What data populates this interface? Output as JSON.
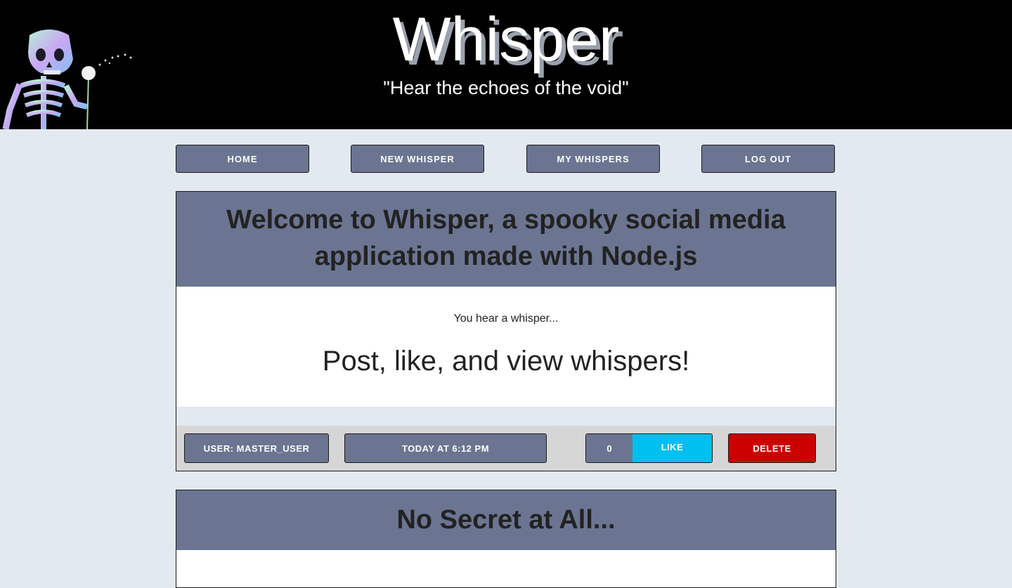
{
  "header": {
    "title": "Whisper",
    "tagline": "\"Hear the echoes of the void\""
  },
  "nav": {
    "items": [
      {
        "label": "HOME"
      },
      {
        "label": "NEW WHISPER"
      },
      {
        "label": "MY WHISPERS"
      },
      {
        "label": "LOG OUT"
      }
    ]
  },
  "posts": [
    {
      "title": "Welcome to Whisper, a spooky social media application made with Node.js",
      "subtitle": "You hear a whisper...",
      "text": "Post, like, and view whispers!",
      "user_label": "USER: MASTER_USER",
      "timestamp": "TODAY AT 6:12 PM",
      "like_count": "0",
      "like_label": "LIKE",
      "delete_label": "DELETE"
    },
    {
      "title": "No Secret at All..."
    }
  ],
  "colors": {
    "header_bg": "#000000",
    "page_bg": "#e3e9f0",
    "slate": "#6b7591",
    "like": "#00c0f0",
    "delete": "#cc0000"
  },
  "icons": {
    "header_image": "skeleton-with-dandelion"
  }
}
